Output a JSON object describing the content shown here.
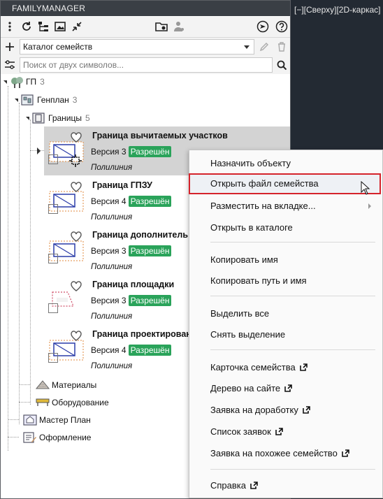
{
  "viewport": {
    "label": "[−][Сверху][2D-каркас]"
  },
  "panel": {
    "title": "FAMILYMANAGER",
    "catalog": {
      "selected": "Каталог семейств"
    },
    "search": {
      "placeholder": "Поиск от двух символов..."
    }
  },
  "tree": {
    "root": {
      "label": "ГП",
      "count": "3"
    },
    "genplan": {
      "label": "Генплан",
      "count": "3"
    },
    "borders": {
      "label": "Границы",
      "count": "5"
    },
    "items": [
      {
        "name": "Граница вычитаемых участков",
        "version": "Версия 3",
        "status": "Разрешён",
        "type": "Полилиния"
      },
      {
        "name": "Граница ГПЗУ",
        "version": "Версия 4",
        "status": "Разрешён",
        "type": "Полилиния"
      },
      {
        "name": "Граница дополнитель",
        "version": "Версия 3",
        "status": "Разрешён",
        "type": "Полилиния"
      },
      {
        "name": "Граница площадки",
        "version": "Версия 3",
        "status": "Разрешён",
        "type": "Полилиния"
      },
      {
        "name": "Граница проектирован",
        "version": "Версия 4",
        "status": "Разрешён",
        "type": "Полилиния"
      }
    ],
    "materials": "Материалы",
    "equipment": "Оборудование",
    "master_plan": "Мастер План",
    "design": "Оформление"
  },
  "context_menu": {
    "items": [
      "Назначить объекту",
      "Открыть файл семейства",
      "Разместить на вкладке...",
      "Открыть в каталоге",
      "Копировать имя",
      "Копировать путь и имя",
      "Выделить все",
      "Снять выделение",
      "Карточка семейства",
      "Дерево на сайте",
      "Заявка на доработку",
      "Список заявок",
      "Заявка на похожее семейство",
      "Справка"
    ]
  },
  "colors": {
    "status_green": "#2aa35a",
    "highlight_red": "#d5232b",
    "title_bar": "#3a3f45"
  }
}
